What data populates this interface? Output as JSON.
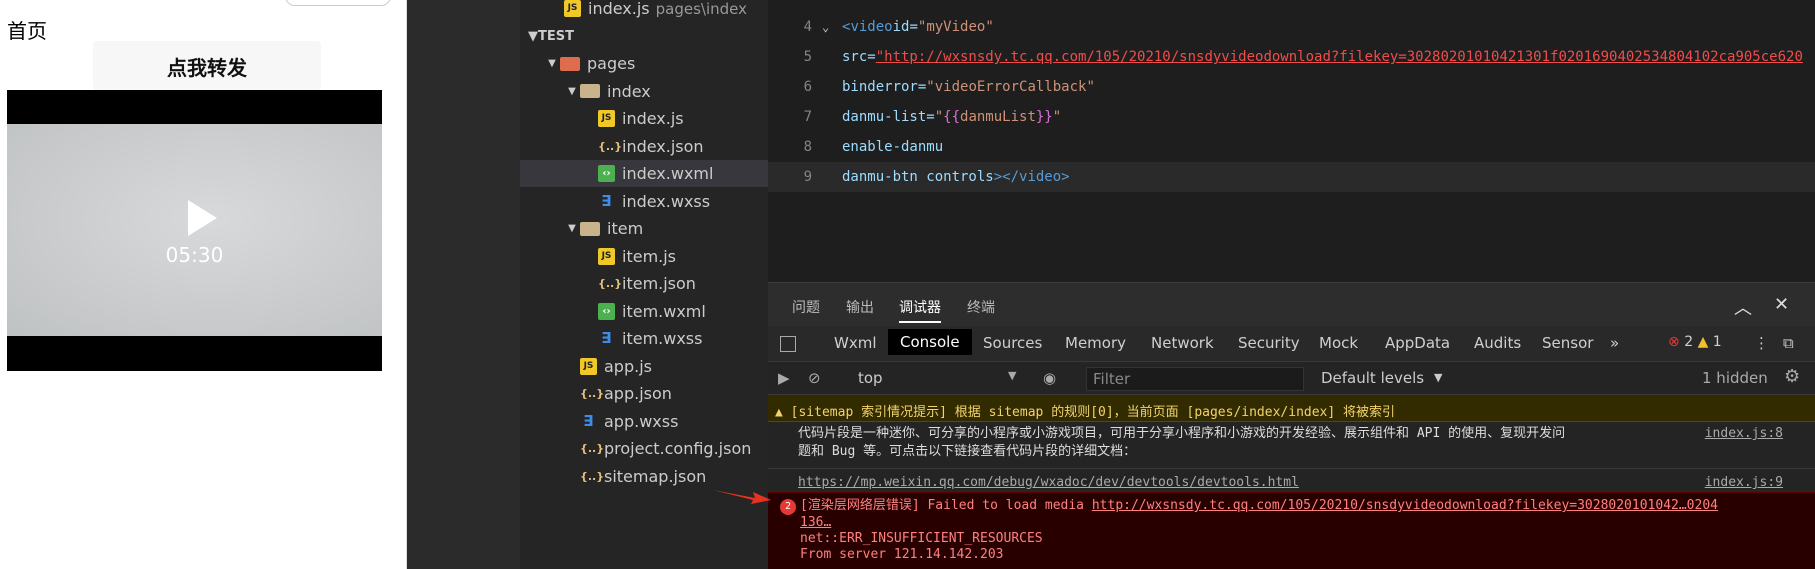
{
  "simulator": {
    "page_title": "首页",
    "share_button": "点我转发",
    "video_duration": "05:30"
  },
  "explorer": {
    "top_file": "index.js",
    "top_file_path": "pages\\index",
    "section": "TEST",
    "items": [
      {
        "label": "pages",
        "icon": "folder-icon"
      },
      {
        "label": "index",
        "icon": "folder-icon"
      },
      {
        "label": "index.js",
        "icon": "js-file-icon"
      },
      {
        "label": "index.json",
        "icon": "json-file-icon"
      },
      {
        "label": "index.wxml",
        "icon": "wxml-file-icon"
      },
      {
        "label": "index.wxss",
        "icon": "wxss-file-icon"
      },
      {
        "label": "item",
        "icon": "folder-icon"
      },
      {
        "label": "item.js",
        "icon": "js-file-icon"
      },
      {
        "label": "item.json",
        "icon": "json-file-icon"
      },
      {
        "label": "item.wxml",
        "icon": "wxml-file-icon"
      },
      {
        "label": "item.wxss",
        "icon": "wxss-file-icon"
      },
      {
        "label": "app.js",
        "icon": "js-file-icon"
      },
      {
        "label": "app.json",
        "icon": "json-file-icon"
      },
      {
        "label": "app.wxss",
        "icon": "wxss-file-icon"
      },
      {
        "label": "project.config.json",
        "icon": "json-file-icon"
      },
      {
        "label": "sitemap.json",
        "icon": "json-file-icon"
      }
    ]
  },
  "editor": {
    "lines": [
      {
        "no": "4",
        "open": "<",
        "tag": "video",
        "attr": " id=",
        "val": "\"myVideo\""
      },
      {
        "no": "5",
        "attr": "src=",
        "val": "\"http://wxsnsdy.tc.qq.com/105/20210/snsdyvideodownload?filekey=30280201010421301f0201690402534804102ca905ce620"
      },
      {
        "no": "6",
        "attr": "binderror=",
        "val": "\"videoErrorCallback\""
      },
      {
        "no": "7",
        "attr": "danmu-list=",
        "q": "\"",
        "brace_open": "{{",
        "var": "danmuList",
        "brace_close": "}}"
      },
      {
        "no": "8",
        "attr": "enable-danmu"
      },
      {
        "no": "9",
        "attr": "danmu-btn controls",
        "close_tag": "></",
        "tag": "video",
        "end": ">"
      }
    ]
  },
  "devtools": {
    "tabs": [
      "问题",
      "输出",
      "调试器",
      "终端"
    ],
    "console_tabs": [
      "Wxml",
      "Console",
      "Sources",
      "Memory",
      "Network",
      "Security",
      "Mock",
      "AppData",
      "Audits",
      "Sensor"
    ],
    "more": "»",
    "error_count": "2",
    "warn_count": "1",
    "context": "top",
    "filter_placeholder": "Filter",
    "levels": "Default levels",
    "hidden": "1 hidden"
  },
  "console": {
    "warn_msg": "[sitemap 索引情况提示] 根据 sitemap 的规则[0]，当前页面 [pages/index/index] 将被索引",
    "info_line1": "代码片段是一种迷你、可分享的小程序或小游戏项目，可用于分享小程序和小游戏的开发经验、展示组件和 API 的使用、复现开发问",
    "info_line2": "题和 Bug 等。可点击以下链接查看代码片段的详细文档：",
    "info_src": "index.js:8",
    "link": "https://mp.weixin.qq.com/debug/wxadoc/dev/devtools/devtools.html",
    "link_src": "index.js:9",
    "err_count": "2",
    "err_prefix": "[渲染层网络层错误] Failed to load media ",
    "err_url": "http://wxsnsdy.tc.qq.com/105/20210/snsdyvideodownload?filekey=3028020101042…0204",
    "err_url2": "136…",
    "err_line2": "net::ERR_INSUFFICIENT_RESOURCES",
    "err_line3": "From server 121.14.142.203"
  },
  "colors": {
    "error": "#e53935",
    "warning": "#f2d36c",
    "annotation_arrow": "#e8321f"
  }
}
